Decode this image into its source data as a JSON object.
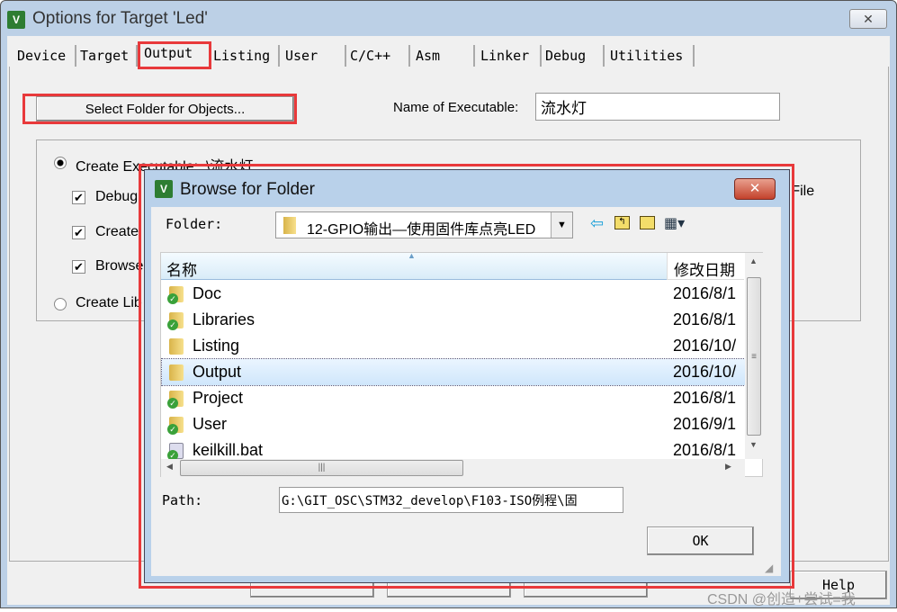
{
  "window": {
    "title": "Options for Target 'Led'",
    "close": "✕"
  },
  "tabs": [
    {
      "label": "Device"
    },
    {
      "label": "Target"
    },
    {
      "label": "Output"
    },
    {
      "label": "Listing"
    },
    {
      "label": "User"
    },
    {
      "label": "C/C++"
    },
    {
      "label": "Asm"
    },
    {
      "label": "Linker"
    },
    {
      "label": "Debug"
    },
    {
      "label": "Utilities"
    }
  ],
  "active_tab": "Output",
  "output": {
    "select_folder_label": "Select Folder for Objects...",
    "name_label": "Name of Executable:",
    "name_value": "流水灯",
    "create_exec_label": "Create Executable:  .\\流水灯",
    "debug_label": "Debug",
    "create_label": "Create",
    "browse_label": "Browse",
    "create_lib_label": "Create Lib",
    "file_label": "n File"
  },
  "footer": {
    "help_label": "Help"
  },
  "watermark": "CSDN @创造+尝试=我",
  "dialog": {
    "title": "Browse for Folder",
    "close": "✕",
    "folder_label": "Folder:",
    "folder_value": "12-GPIO输出—使用固件库点亮LED",
    "columns": [
      "名称",
      "修改日期"
    ],
    "items": [
      {
        "name": "Doc",
        "date": "2016/8/1",
        "type": "folder-synced"
      },
      {
        "name": "Libraries",
        "date": "2016/8/1",
        "type": "folder-synced"
      },
      {
        "name": "Listing",
        "date": "2016/10/",
        "type": "folder"
      },
      {
        "name": "Output",
        "date": "2016/10/",
        "type": "folder",
        "selected": true
      },
      {
        "name": "Project",
        "date": "2016/8/1",
        "type": "folder-synced"
      },
      {
        "name": "User",
        "date": "2016/9/1",
        "type": "folder-synced"
      },
      {
        "name": "keilkill.bat",
        "date": "2016/8/1",
        "type": "file-synced"
      }
    ],
    "path_label": "Path:",
    "path_value": "G:\\GIT_OSC\\STM32_develop\\F103-ISO例程\\固",
    "ok_label": "OK"
  },
  "colors": {
    "highlight": "#e8393b",
    "selection": "#cce8ff"
  }
}
